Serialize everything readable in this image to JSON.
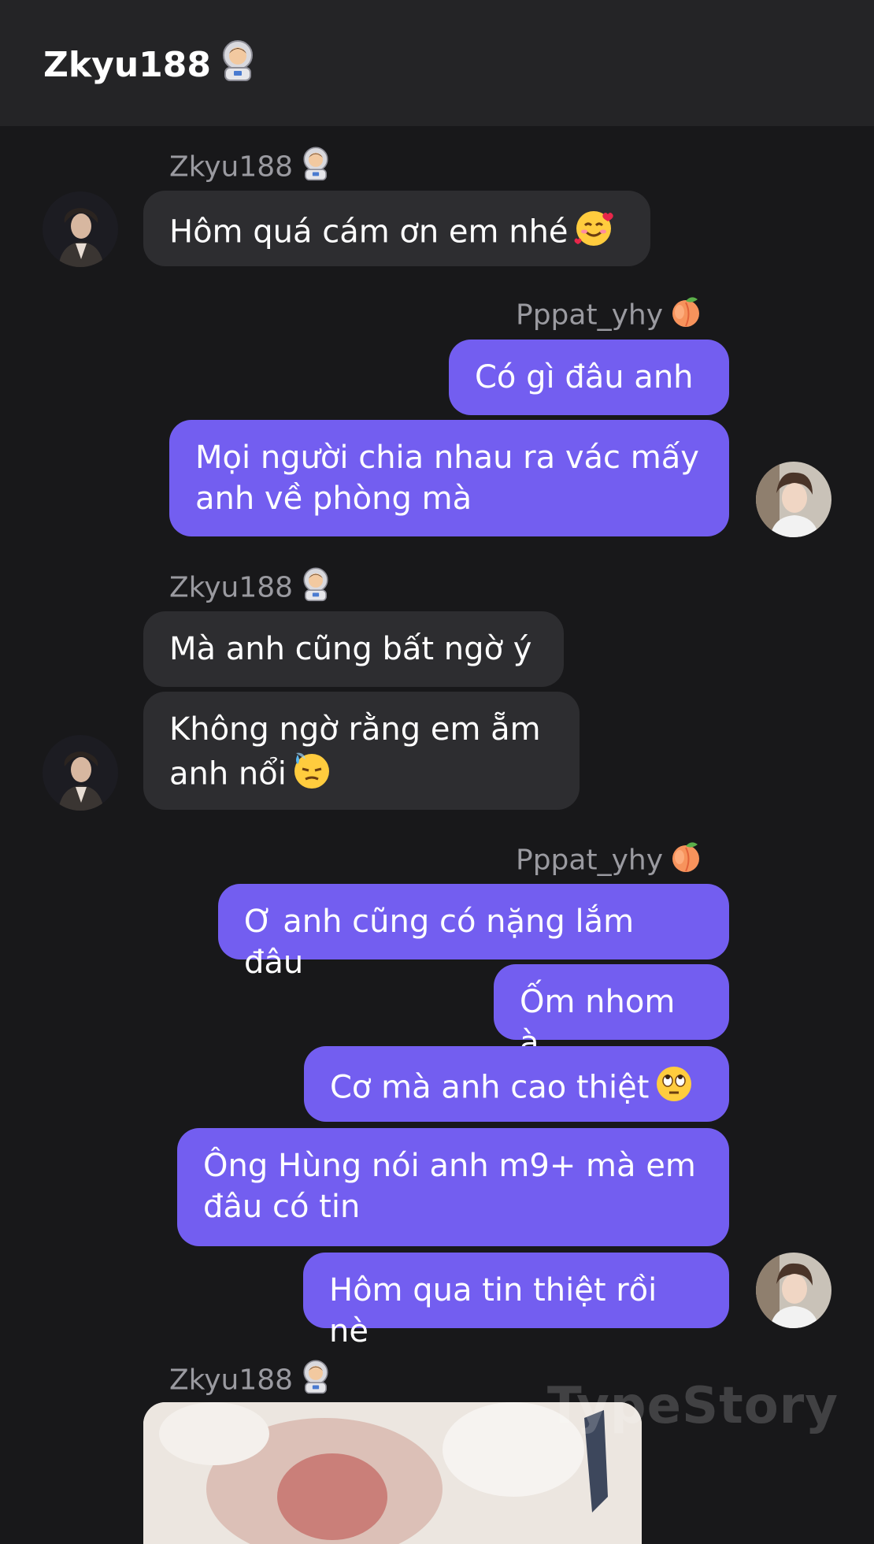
{
  "header": {
    "title": "Zkyu188",
    "title_emoji": "astronaut-icon"
  },
  "watermark": "TypeStory",
  "senders": {
    "s1": "Zkyu188",
    "s2": "Pppat_yhy",
    "s3": "Zkyu188",
    "s4": "Pppat_yhy",
    "s5": "Zkyu188"
  },
  "messages": {
    "m1": "Hôm quá cám ơn em nhé",
    "m2": "Có gì đâu anh",
    "m3": "Mọi người chia nhau ra vác mấy anh về phòng mà",
    "m4": "Mà anh cũng bất ngờ ý",
    "m5": "Không ngờ rằng em ẵm anh nổi",
    "m6": "Ơ anh cũng có nặng lắm đâu",
    "m7": "Ốm nhom à",
    "m8": "Cơ mà anh cao thiệt",
    "m9": "Ông Hùng nói anh m9+ mà em đâu có tin",
    "m10": "Hôm qua tin thiệt rồi nè"
  },
  "icons": {
    "zkyu_badge": "astronaut-icon",
    "pppat_badge": "peach-icon",
    "m1_emoji": "smiling-face-with-hearts-icon",
    "m5_emoji": "downcast-face-with-sweat-icon",
    "m8_emoji": "face-with-rolling-eyes-icon"
  },
  "colors": {
    "background": "#18181a",
    "header": "#242426",
    "incoming_bubble": "#2d2d30",
    "outgoing_bubble": "#735ef0",
    "sender_name": "#9a9aa0"
  }
}
